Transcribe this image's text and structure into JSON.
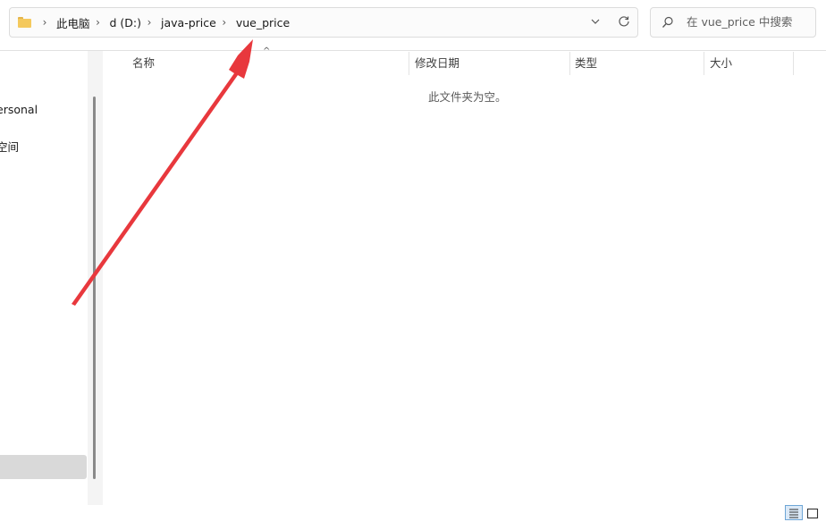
{
  "address_bar": {
    "breadcrumbs": [
      "此电脑",
      "d (D:)",
      "java-price",
      "vue_price"
    ],
    "separator": "›",
    "history_chevron": "⌄"
  },
  "search": {
    "placeholder": "在 vue_price 中搜索"
  },
  "nav": {
    "items": [
      "ersonal",
      "空间"
    ]
  },
  "file_list": {
    "columns": [
      "名称",
      "修改日期",
      "类型",
      "大小"
    ],
    "sort_indicator": "^",
    "empty_message": "此文件夹为空。"
  },
  "icons": {
    "folder": "folder-icon",
    "chevron": "chevron-down-icon",
    "refresh": "refresh-icon",
    "search": "search-icon",
    "details_view": "details-view-icon",
    "tiles_view": "tiles-view-icon"
  },
  "colors": {
    "folder": "#f4c95d",
    "annotation_arrow": "#e8383d",
    "selection": "#d9d9d9"
  }
}
